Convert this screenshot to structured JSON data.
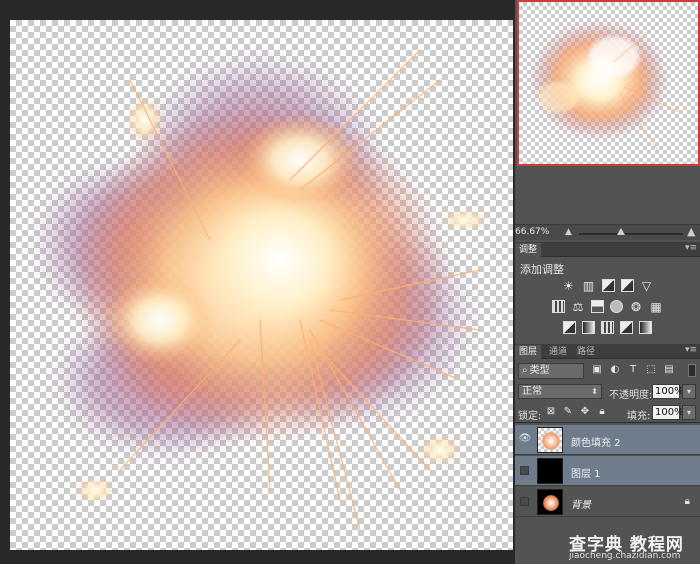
{
  "navigator": {
    "zoom": "66.67%"
  },
  "adjustments": {
    "tab": "调整",
    "add_label": "添加调整",
    "row1_icons": [
      "brightness-contrast-icon",
      "levels-icon",
      "curves-icon",
      "exposure-icon",
      "vibrance-icon"
    ],
    "row2_icons": [
      "hue-saturation-icon",
      "color-balance-icon",
      "black-white-icon",
      "photo-filter-icon",
      "channel-mixer-icon",
      "color-lookup-icon"
    ],
    "row3_icons": [
      "invert-icon",
      "posterize-icon",
      "threshold-icon",
      "selective-color-icon",
      "gradient-map-icon"
    ]
  },
  "layers_panel": {
    "tabs": [
      "图层",
      "通道",
      "路径"
    ],
    "kind_filter": "类型",
    "blend_mode": "正常",
    "opacity_label": "不透明度:",
    "opacity_value": "100%",
    "lock_label": "锁定:",
    "fill_label": "填充:",
    "fill_value": "100%",
    "layers": [
      {
        "name": "颜色填充 2",
        "visible": true,
        "selected": true
      },
      {
        "name": "图层 1",
        "visible": false,
        "selected": true
      },
      {
        "name": "背景",
        "visible": false,
        "selected": false,
        "locked": true
      }
    ]
  },
  "watermark": {
    "main": "查字典 教程网",
    "url": "jiaocheng.chazidian.com"
  },
  "colors": {
    "panel": "#535353",
    "selection": "#6f7c8c",
    "navigator_border": "#d23c3c"
  }
}
